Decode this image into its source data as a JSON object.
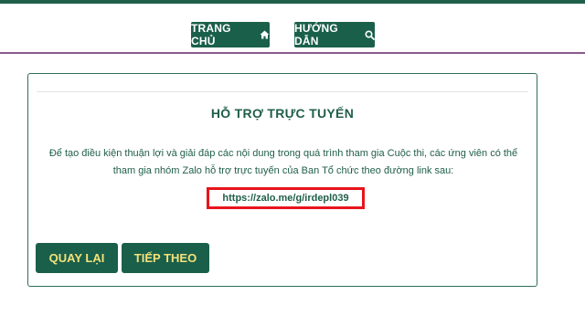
{
  "header": {
    "nav": {
      "home_label": "TRANG CHỦ",
      "home_icon": "home-icon",
      "guide_label": "HƯỚNG DẪN",
      "guide_icon": "search-icon"
    }
  },
  "support": {
    "title": "HỖ TRỢ TRỰC TUYẾN",
    "description": "Để tạo điều kiện thuận lợi và giải đáp các nội dung trong quá trình tham gia Cuộc thi, các ứng viên có thể tham gia nhóm Zalo hỗ trợ trực tuyến của Ban Tổ chức theo đường link sau:",
    "link_text": "https://zalo.me/g/irdepl039"
  },
  "actions": {
    "back_label": "QUAY LẠI",
    "next_label": "TIẾP THEO"
  },
  "colors": {
    "primary": "#1a5f4a",
    "accent_text": "#f2e27a",
    "highlight_border": "#e8141c",
    "header_border": "#8a5a8e"
  }
}
